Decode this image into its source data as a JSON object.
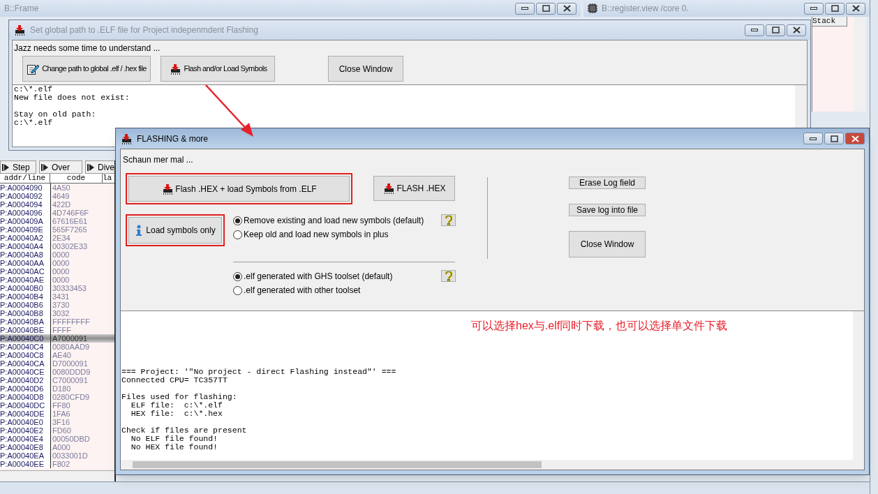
{
  "background_windows": [
    {
      "title": "B::Frame",
      "active": false
    },
    {
      "title": "B::register.view /core 0.",
      "active": false
    }
  ],
  "stack_panel": {
    "header": "Stack"
  },
  "disassembly": {
    "toolbar": [
      "Step",
      "Over",
      "Dive"
    ],
    "columns": [
      "addr/line",
      "code",
      "la"
    ],
    "rows": [
      {
        "addr": "P:A0004090",
        "code": "4A50",
        "selected": false
      },
      {
        "addr": "P:A0004092",
        "code": "4649",
        "selected": false
      },
      {
        "addr": "P:A0004094",
        "code": "422D",
        "selected": false
      },
      {
        "addr": "P:A0004096",
        "code": "4D746F6F",
        "selected": false
      },
      {
        "addr": "P:A000409A",
        "code": "67616E61",
        "selected": false
      },
      {
        "addr": "P:A000409E",
        "code": "565F7265",
        "selected": false
      },
      {
        "addr": "P:A00040A2",
        "code": "2E34",
        "selected": false
      },
      {
        "addr": "P:A00040A4",
        "code": "00302E33",
        "selected": false
      },
      {
        "addr": "P:A00040A8",
        "code": "0000",
        "selected": false
      },
      {
        "addr": "P:A00040AA",
        "code": "0000",
        "selected": false
      },
      {
        "addr": "P:A00040AC",
        "code": "0000",
        "selected": false
      },
      {
        "addr": "P:A00040AE",
        "code": "0000",
        "selected": false
      },
      {
        "addr": "P:A00040B0",
        "code": "30333453",
        "selected": false
      },
      {
        "addr": "P:A00040B4",
        "code": "3431",
        "selected": false
      },
      {
        "addr": "P:A00040B6",
        "code": "3730",
        "selected": false
      },
      {
        "addr": "P:A00040B8",
        "code": "3032",
        "selected": false
      },
      {
        "addr": "P:A00040BA",
        "code": "FFFFFFFF",
        "selected": false
      },
      {
        "addr": "P:A00040BE",
        "code": "FFFF",
        "selected": false
      },
      {
        "addr": "P:A00040C0",
        "code": "A7000091",
        "selected": true
      },
      {
        "addr": "P:A00040C4",
        "code": "0080AAD9",
        "selected": false
      },
      {
        "addr": "P:A00040C8",
        "code": "AE40",
        "selected": false
      },
      {
        "addr": "P:A00040CA",
        "code": "D7000091",
        "selected": false
      },
      {
        "addr": "P:A00040CE",
        "code": "0080DDD9",
        "selected": false
      },
      {
        "addr": "P:A00040D2",
        "code": "C7000091",
        "selected": false
      },
      {
        "addr": "P:A00040D6",
        "code": "D180",
        "selected": false
      },
      {
        "addr": "P:A00040D8",
        "code": "0280CFD9",
        "selected": false
      },
      {
        "addr": "P:A00040DC",
        "code": "FF80",
        "selected": false
      },
      {
        "addr": "P:A00040DE",
        "code": "1FA6",
        "selected": false
      },
      {
        "addr": "P:A00040E0",
        "code": "3F16",
        "selected": false
      },
      {
        "addr": "P:A00040E2",
        "code": "FD60",
        "selected": false
      },
      {
        "addr": "P:A00040E4",
        "code": "00050DBD",
        "selected": false
      },
      {
        "addr": "P:A00040E8",
        "code": "A000",
        "selected": false
      },
      {
        "addr": "P:A00040EA",
        "code": "0033001D",
        "selected": false
      },
      {
        "addr": "P:A00040EE",
        "code": "F802",
        "selected": false
      }
    ]
  },
  "path_window": {
    "title": "Set global path to .ELF file for Project indepenmdent Flashing",
    "active": false,
    "message": "Jazz needs some time to understand ...",
    "buttons": [
      {
        "label": "Change path to global .elf / .hex file"
      },
      {
        "label": "Flash and/or Load Symbols"
      },
      {
        "label": "Close Window"
      }
    ],
    "log": [
      [
        "c:\\*.elf",
        "New file does not exist:"
      ],
      [
        "Stay on old path:",
        "c:\\*.elf"
      ]
    ]
  },
  "flash_window": {
    "title": "FLASHING & more",
    "active": true,
    "message": "Schaun mer mal ...",
    "flash_buttons": [
      {
        "label": "Flash .HEX + load Symbols from .ELF",
        "highlighted": true
      },
      {
        "label": "FLASH .HEX",
        "highlighted": false
      }
    ],
    "load_button": {
      "label": "Load symbols only",
      "highlighted": true
    },
    "symbol_options": [
      {
        "label": "Remove existing and load new symbols (default)",
        "selected": true
      },
      {
        "label": "Keep old and load new symbols in plus",
        "selected": false
      }
    ],
    "toolset_options": [
      {
        "label": ".elf generated with GHS toolset (default)",
        "selected": true
      },
      {
        "label": ".elf generated with other toolset",
        "selected": false
      }
    ],
    "side_buttons": [
      {
        "label": "Erase Log field"
      },
      {
        "label": "Save log into file"
      },
      {
        "label": "Close Window"
      }
    ],
    "log": [
      [
        "=== Project: '\"No project - direct Flashing instead\"' ===",
        "Connected CPU= TC357TT"
      ],
      [
        "Files used for flashing:",
        "  ELF file:  c:\\*.elf",
        "  HEX file:  c:\\*.hex"
      ],
      [
        "Check if files are present",
        "  No ELF file found!",
        "  No HEX file found!"
      ]
    ]
  },
  "annotation": {
    "note": "可以选择hex与.elf同时下载，也可以选择单文件下载"
  }
}
